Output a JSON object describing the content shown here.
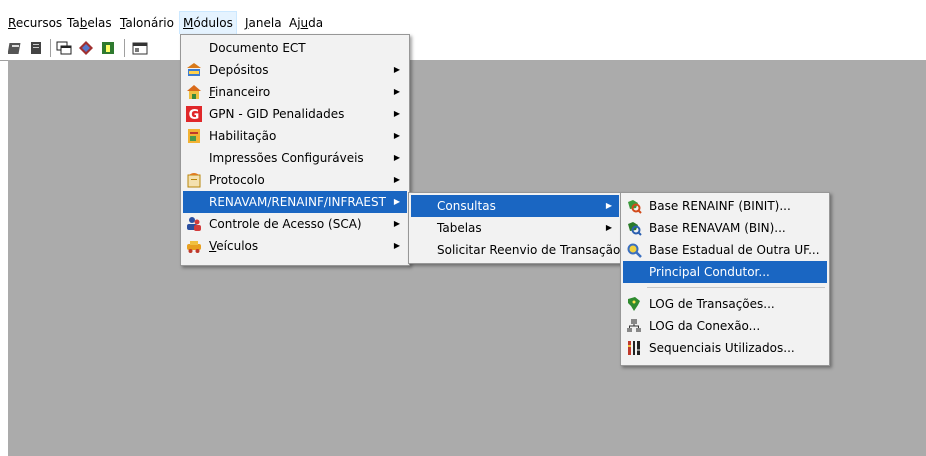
{
  "menubar": {
    "items": [
      {
        "prefix": "",
        "accel": "R",
        "suffix": "ecursos"
      },
      {
        "prefix": "Ta",
        "accel": "b",
        "suffix": "elas"
      },
      {
        "prefix": "",
        "accel": "T",
        "suffix": "alonário"
      },
      {
        "prefix": "",
        "accel": "M",
        "suffix": "ódulos"
      },
      {
        "prefix": "",
        "accel": "J",
        "suffix": "anela"
      },
      {
        "prefix": "Aj",
        "accel": "u",
        "suffix": "da"
      }
    ]
  },
  "modulos_menu": {
    "items": [
      {
        "label": "Documento ECT"
      },
      {
        "label": "Depósitos"
      },
      {
        "prefix": "",
        "accel": "F",
        "suffix": "inanceiro"
      },
      {
        "label": "GPN - GID Penalidades"
      },
      {
        "label": "Habilitação"
      },
      {
        "label": "Impressões Configuráveis"
      },
      {
        "label": "Protocolo"
      },
      {
        "label": "RENAVAM/RENAINF/INFRAEST"
      },
      {
        "label": "Controle de Acesso (SCA)"
      },
      {
        "prefix": "",
        "accel": "V",
        "suffix": "eículos"
      }
    ]
  },
  "renavam_menu": {
    "items": [
      {
        "label": "Consultas"
      },
      {
        "label": "Tabelas"
      },
      {
        "label": "Solicitar Reenvio de Transação"
      }
    ]
  },
  "consultas_menu": {
    "items": [
      {
        "label": "Base RENAINF (BINIT)..."
      },
      {
        "label": "Base RENAVAM (BIN)..."
      },
      {
        "label": "Base Estadual de Outra UF..."
      },
      {
        "label": "Principal Condutor..."
      },
      {
        "label": "LOG de Transações..."
      },
      {
        "label": "LOG da Conexão..."
      },
      {
        "label": "Sequenciais Utilizados..."
      }
    ]
  },
  "colors": {
    "highlight": "#1a66c2",
    "workspace": "#ababab",
    "menu_bg": "#f2f2f2"
  }
}
